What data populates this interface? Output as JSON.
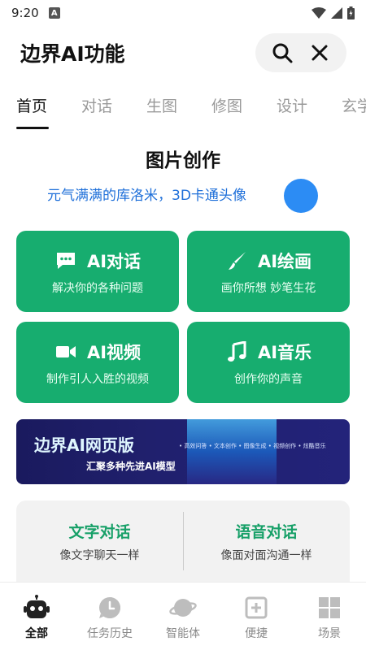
{
  "status_bar": {
    "time": "9:20",
    "notification_letter": "A"
  },
  "header": {
    "title": "边界AI功能"
  },
  "tabs": [
    {
      "label": "首页",
      "active": true
    },
    {
      "label": "对话",
      "active": false
    },
    {
      "label": "生图",
      "active": false
    },
    {
      "label": "修图",
      "active": false
    },
    {
      "label": "设计",
      "active": false
    },
    {
      "label": "玄学",
      "active": false
    }
  ],
  "section": {
    "title": "图片创作",
    "promo_text": "元气满满的库洛米，3D卡通头像"
  },
  "cards": [
    {
      "title": "AI对话",
      "subtitle": "解决你的各种问题",
      "icon": "chat-bubble-icon"
    },
    {
      "title": "AI绘画",
      "subtitle": "画你所想 妙笔生花",
      "icon": "brush-icon"
    },
    {
      "title": "AI视频",
      "subtitle": "制作引人入胜的视频",
      "icon": "video-camera-icon"
    },
    {
      "title": "AI音乐",
      "subtitle": "创作你的声音",
      "icon": "music-note-icon"
    }
  ],
  "banner": {
    "title": "边界AI网页版",
    "subtitle": "汇聚多种先进AI模型",
    "tags": "• 高效问答  • 文本创作  • 图像生成  • 视频创作  • 炫酷音乐"
  },
  "chat_modes": [
    {
      "title": "文字对话",
      "subtitle": "像文字聊天一样"
    },
    {
      "title": "语音对话",
      "subtitle": "像面对面沟通一样"
    }
  ],
  "bottom_nav": [
    {
      "label": "全部",
      "icon": "robot-icon",
      "active": true
    },
    {
      "label": "任务历史",
      "icon": "clock-icon",
      "active": false
    },
    {
      "label": "智能体",
      "icon": "planet-icon",
      "active": false
    },
    {
      "label": "便捷",
      "icon": "plus-square-icon",
      "active": false
    },
    {
      "label": "场景",
      "icon": "grid-icon",
      "active": false
    }
  ],
  "colors": {
    "accent": "#17ad6f",
    "link": "#1e6fd9",
    "chat_title": "#17a068"
  }
}
